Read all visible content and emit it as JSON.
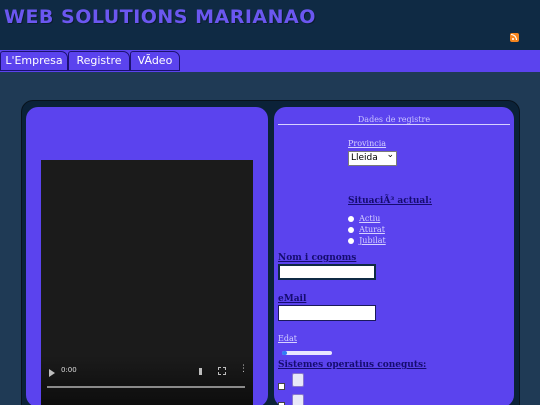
{
  "header": {
    "site_title": "WEB SOLUTIONS MARIANAO",
    "rss_icon": "rss-icon"
  },
  "nav": {
    "tabs": [
      {
        "label": "L'Empresa"
      },
      {
        "label": "Registre"
      },
      {
        "label": "VÃdeo"
      }
    ]
  },
  "video": {
    "time": "0:00",
    "progress": 0
  },
  "form": {
    "legend": "Dades de registre",
    "provincia_label": "Provincia",
    "provincia_value": "Lleida",
    "situacio_label": "SituaciÃ³ actual:",
    "situacio_options": [
      "Actiu",
      "Aturat",
      "Jubilat"
    ],
    "nom_label": "Nom i cognoms",
    "nom_value": "",
    "email_label": "eMail",
    "email_value": "",
    "edat_label": "Edat",
    "edat_level": 0.1,
    "sistemes_label": "Sistemes operatius coneguts:",
    "os_icons": [
      "os-icon-1",
      "os-icon-2"
    ]
  },
  "colors": {
    "accent": "#5b43ee",
    "header": "#0f2a44",
    "title": "#6b57f0"
  }
}
